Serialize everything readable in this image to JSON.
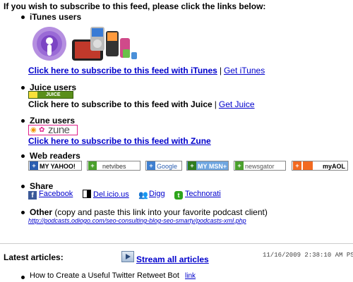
{
  "intro": "If you wish to subscribe to this feed, please click the links below:",
  "itunes": {
    "heading": "iTunes users",
    "link": "Click here to subscribe to this feed with iTunes",
    "sep": "|",
    "get": "Get iTunes"
  },
  "juice": {
    "heading": "Juice users",
    "badge": "JUICE",
    "line_text": "Click here to subscribe to this feed with Juice",
    "sep": "|",
    "get": "Get Juice"
  },
  "zune": {
    "heading": "Zune users",
    "badge": "zune",
    "link": "Click here to subscribe to this feed with Zune"
  },
  "web_readers": {
    "heading": "Web readers",
    "buttons": {
      "yahoo": "MY YAHOO!",
      "netvibes": "netvibes",
      "google": "Google",
      "msn": "MY MSN+",
      "newsgator": "newsgator",
      "aol": "myAOL"
    }
  },
  "share": {
    "heading": "Share",
    "items": {
      "facebook": "Facebook",
      "delicious": "Del.icio.us",
      "digg": "Digg",
      "technorati": "Technorati"
    }
  },
  "other": {
    "heading": "Other",
    "note": "(copy and paste this link into your favorite podcast client)",
    "url": "http://podcasts.odiogo.com/seo-consulting-blog-seo-smarty/podcasts-xml.php"
  },
  "latest": {
    "label": "Latest articles:",
    "stream": "Stream all articles",
    "timestamp": "11/16/2009 2:38:10 AM PS",
    "article_title": "How to Create a Useful Twitter Retweet Bot",
    "article_link": "link"
  },
  "colors": {
    "link": "#0000cc",
    "itunes_purple": "#8a4fc7",
    "juice_green": "#5a8f1a",
    "zune_pink": "#e0218a"
  }
}
